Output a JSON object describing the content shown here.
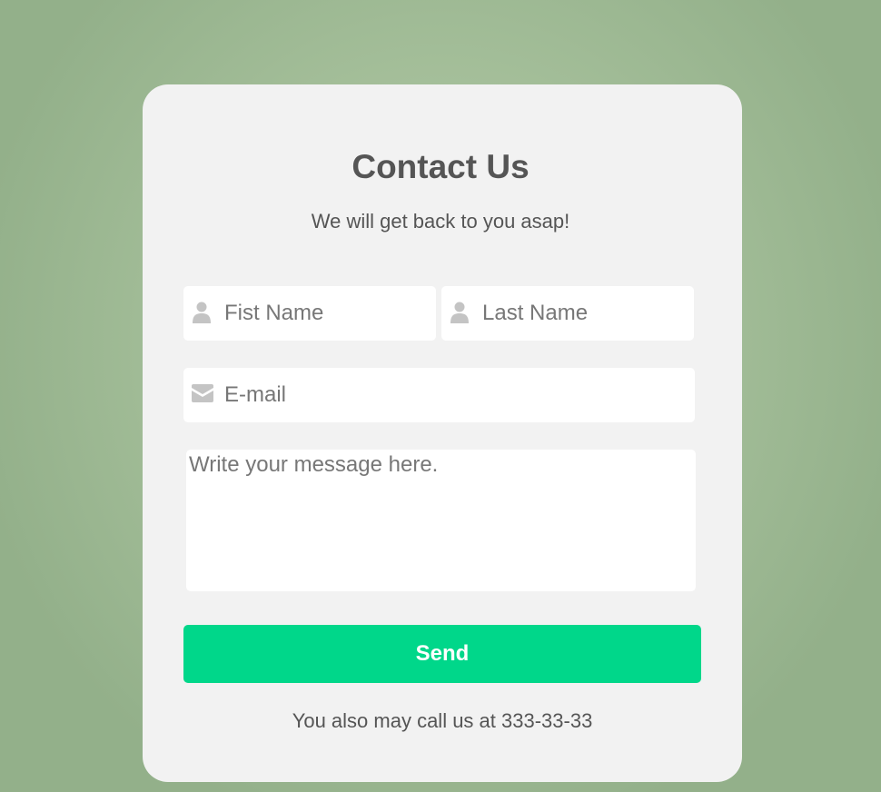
{
  "colors": {
    "background": "#a7c19c",
    "card": "#f2f2f2",
    "text": "#555555",
    "accent": "#00d78a",
    "icon": "#c4c4c4",
    "placeholder": "#777777"
  },
  "header": {
    "title": "Contact Us",
    "subtitle": "We will get back to you asap!"
  },
  "form": {
    "first_name": {
      "placeholder": "Fist Name",
      "value": "",
      "icon": "user-icon"
    },
    "last_name": {
      "placeholder": "Last Name",
      "value": "",
      "icon": "user-icon"
    },
    "email": {
      "placeholder": "E-mail",
      "value": "",
      "icon": "envelope-icon"
    },
    "message": {
      "placeholder": "Write your message here.",
      "value": ""
    },
    "send_label": "Send"
  },
  "footer": {
    "note": "You also may call us at 333-33-33"
  }
}
